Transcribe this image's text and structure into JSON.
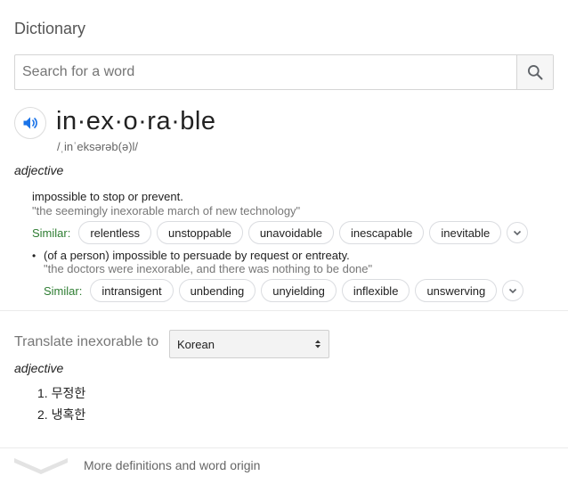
{
  "header": {
    "title": "Dictionary"
  },
  "search": {
    "placeholder": "Search for a word",
    "value": ""
  },
  "entry": {
    "headword": "in·ex·o·ra·ble",
    "phonetic": "/ˌinˈeksərəb(ə)l/",
    "pos": "adjective",
    "senses": [
      {
        "definition": "impossible to stop or prevent.",
        "example": "\"the seemingly inexorable march of new technology\"",
        "similar_label": "Similar:",
        "similar": [
          "relentless",
          "unstoppable",
          "unavoidable",
          "inescapable",
          "inevitable"
        ]
      },
      {
        "bullet": "•",
        "definition": "(of a person) impossible to persuade by request or entreaty.",
        "example": "\"the doctors were inexorable, and there was nothing to be done\"",
        "similar_label": "Similar:",
        "similar": [
          "intransigent",
          "unbending",
          "unyielding",
          "inflexible",
          "unswerving"
        ]
      }
    ]
  },
  "translate": {
    "label": "Translate inexorable to",
    "language": "Korean",
    "pos": "adjective",
    "items": [
      "1. 무정한",
      "2. 냉혹한"
    ]
  },
  "footer": {
    "more_label": "More definitions and word origin"
  },
  "icons": {
    "search": "search-icon",
    "speaker": "speaker-icon",
    "expand": "chevron-down-icon",
    "select": "select-arrows-icon"
  },
  "colors": {
    "speaker": "#1a73e8",
    "similar_label": "#2e7d32",
    "example": "#777777"
  }
}
